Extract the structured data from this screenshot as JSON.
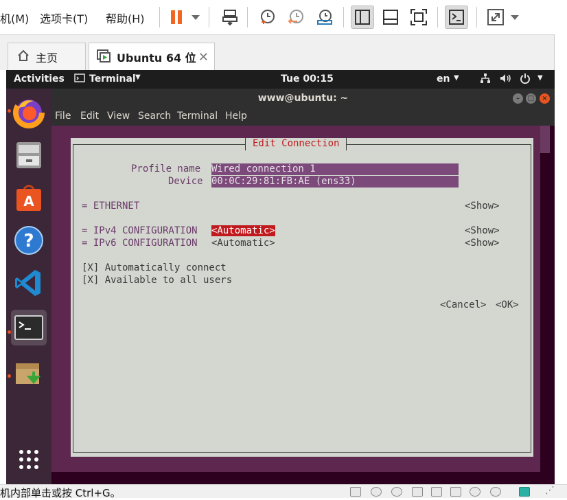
{
  "host": {
    "menus": [
      {
        "label": "机(M)"
      },
      {
        "label": "选项卡(T)"
      },
      {
        "label": "帮助(H)"
      }
    ],
    "tabs": [
      {
        "label": "主页"
      },
      {
        "label": "Ubuntu 64 位"
      }
    ],
    "status_text": "机内部单击或按 Ctrl+G。"
  },
  "ubuntu": {
    "top_bar": {
      "activities": "Activities",
      "app_menu": "Terminal",
      "clock": "Tue 00:15",
      "keyboard": "en"
    },
    "dock_apps": [
      {
        "name": "Firefox",
        "icon": "firefox-icon"
      },
      {
        "name": "Files",
        "icon": "files-icon"
      },
      {
        "name": "Ubuntu Software",
        "icon": "software-center-icon"
      },
      {
        "name": "Help",
        "icon": "help-icon"
      },
      {
        "name": "Visual Studio Code",
        "icon": "vscode-icon"
      },
      {
        "name": "Terminal",
        "icon": "terminal-icon"
      },
      {
        "name": "Archive Manager",
        "icon": "archive-icon"
      },
      {
        "name": "Show Applications",
        "icon": "app-grid-icon"
      }
    ]
  },
  "terminal": {
    "title": "www@ubuntu: ~",
    "menu": [
      "File",
      "Edit",
      "View",
      "Search",
      "Terminal",
      "Help"
    ]
  },
  "nmtui": {
    "dialog_title": "Edit Connection",
    "profile_label": "Profile name",
    "profile_value": "Wired connection 1",
    "device_label": "Device",
    "device_value": "00:0C:29:81:FB:AE (ens33)",
    "ethernet": "= ETHERNET",
    "ipv4": "= IPv4 CONFIGURATION",
    "ipv4_value": "<Automatic>",
    "ipv6": "= IPv6 CONFIGURATION",
    "ipv6_value": "<Automatic>",
    "show_label": "<Show>",
    "auto_connect": "[X] Automatically connect",
    "all_users": "[X] Available to all users",
    "cancel": "<Cancel>",
    "ok": "<OK>"
  },
  "colors": {
    "ubuntu_orange": "#e95420",
    "terminal_purple": "#5e2750",
    "nmtui_bg": "#d3d7cf",
    "nmtui_red": "#c0191e",
    "pause_orange": "#f26522"
  }
}
